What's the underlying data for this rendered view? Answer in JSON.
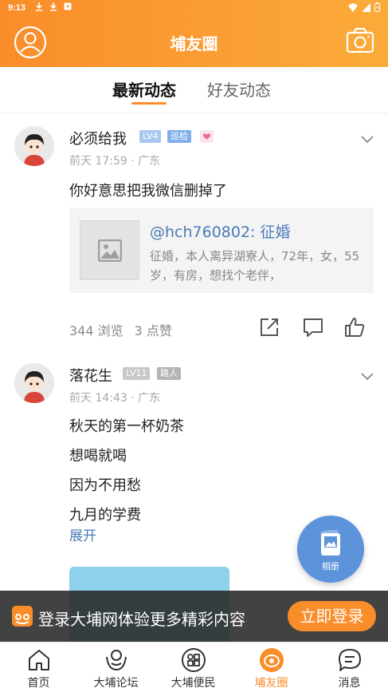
{
  "status_bar": {
    "time": "9:13"
  },
  "header": {
    "title": "埔友圈"
  },
  "tabs": [
    {
      "label": "最新动态",
      "active": true
    },
    {
      "label": "好友动态",
      "active": false
    }
  ],
  "posts": [
    {
      "username": "必须给我",
      "badges": [
        "LV4",
        "巡检"
      ],
      "meta": "前天 17:59 · 广东",
      "text_lines": [
        "你好意思把我微信删掉了"
      ],
      "shared": {
        "title": "@hch760802: 征婚",
        "desc": "征婚，本人离异湖寮人，72年，女，55岁，有房，想找个老伴，"
      },
      "views": "344 浏览",
      "likes": "3 点赞"
    },
    {
      "username": "落花生",
      "badges": [
        "LV11",
        "路人"
      ],
      "meta": "前天 14:43 · 广东",
      "text_lines": [
        "秋天的第一杯奶茶",
        "想喝就喝",
        "因为不用愁",
        "九月的学费"
      ],
      "expand_label": "展开"
    }
  ],
  "fab": {
    "label": "相册"
  },
  "login_banner": {
    "text": "登录大埔网体验更多精彩内容",
    "button": "立即登录"
  },
  "bottom_nav": [
    {
      "label": "首页",
      "icon": "home-icon"
    },
    {
      "label": "大埔论坛",
      "icon": "forum-icon"
    },
    {
      "label": "大埔便民",
      "icon": "services-icon"
    },
    {
      "label": "埔友圈",
      "icon": "circle-icon",
      "active": true
    },
    {
      "label": "消息",
      "icon": "message-icon"
    }
  ],
  "colors": {
    "accent": "#f98d2a",
    "link": "#4a7ab7",
    "fab": "#5c93db"
  }
}
